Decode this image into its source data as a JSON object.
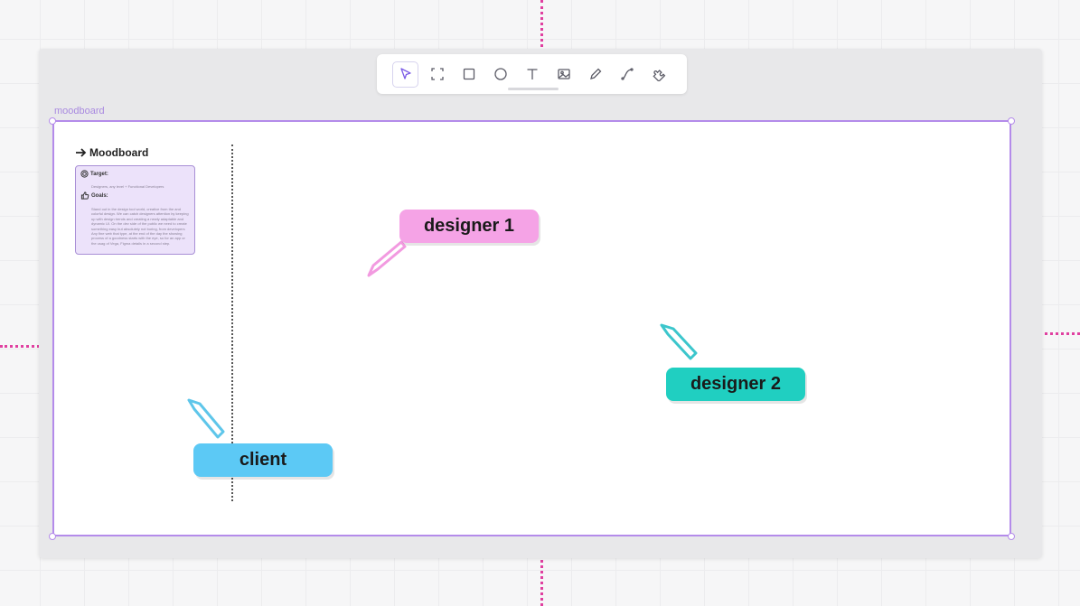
{
  "frame": {
    "label": "moodboard"
  },
  "toolbar": {
    "tools": [
      {
        "name": "select",
        "active": true
      },
      {
        "name": "frame"
      },
      {
        "name": "rectangle"
      },
      {
        "name": "ellipse"
      },
      {
        "name": "text"
      },
      {
        "name": "image"
      },
      {
        "name": "pen"
      },
      {
        "name": "connector"
      },
      {
        "name": "plugin"
      }
    ]
  },
  "moodboard": {
    "title": "Moodboard",
    "target_label": "Target:",
    "target_text": "Designers, any level + Functional Developers",
    "goals_label": "Goals:",
    "goals_text": "Stand out in the design tool world, creative from the and colorful design. We can catch designers attention by keeping up with design trends and creating a newly adaptable and dynamic UI. On the dev side of the public we need to create something easy but absolutely not boring, from developers Any fine web that type, at the end of the day the showing process of a goodness starts with the eye, so for an app or the usag of Vega, Figma details in a second step."
  },
  "collaborators": [
    {
      "name": "designer 1",
      "color": "#f5a3e6",
      "cursor_color": "#f29ae0"
    },
    {
      "name": "designer 2",
      "color": "#20cfc1",
      "cursor_color": "#3cc6cc"
    },
    {
      "name": "client",
      "color": "#5cc9f5",
      "cursor_color": "#5ec6ea"
    }
  ],
  "colors": {
    "guide": "#e040a0",
    "frame_border": "#b48bea",
    "accent": "#7b5ce6"
  }
}
